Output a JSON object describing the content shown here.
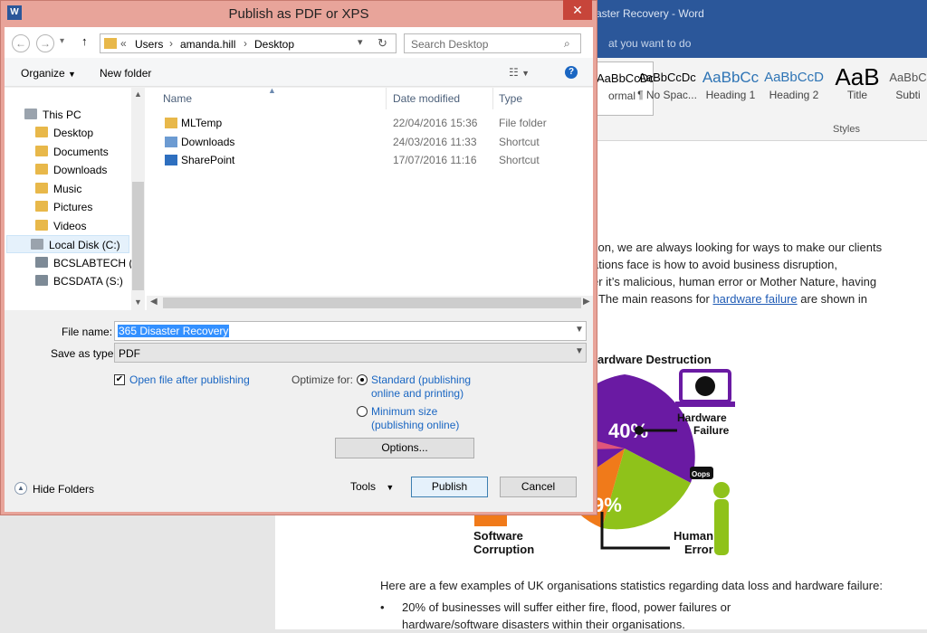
{
  "word": {
    "title": "aster Recovery - Word",
    "tell_me": "at you want to do",
    "styles": [
      {
        "preview": "AaBbCcDc",
        "name": "Normal",
        "shown_name": "ormal"
      },
      {
        "preview": "AaBbCcDc",
        "name": "¶ No Spac..."
      },
      {
        "preview": "AaBbCc",
        "name": "Heading 1"
      },
      {
        "preview": "AaBbCcD",
        "name": "Heading 2"
      },
      {
        "preview": "AaB",
        "name": "Title"
      },
      {
        "preview": "AaBbC",
        "name": "Subti"
      }
    ],
    "styles_group": "Styles",
    "doc_lines": [
      "tion, we are always looking for ways to make our clients",
      "ations face is how to avoid business disruption,",
      "er it’s malicious, human error or Mother Nature, having",
      ". The main reasons for "
    ],
    "doc_link": "hardware failure",
    "doc_line4_tail": " are shown in",
    "infographic": {
      "title": "ardware Destruction",
      "label_hw": "Hardware",
      "label_hw2": "Failure",
      "pct_40": "40%",
      "pct_9": "9%",
      "oops": "Oops",
      "label_sw": "Software",
      "label_sw2": "Corruption",
      "label_he": "Human",
      "label_he2": "Error",
      "colors": {
        "purple": "#6a1aa3",
        "green": "#8fc21a",
        "orange": "#f07a1a",
        "pink": "#e0557a"
      }
    },
    "bottom_para": "Here are a few examples of UK organisations statistics regarding data loss and hardware failure:",
    "bullet_1": "20% of businesses will suffer either fire, flood, power failures or",
    "bullet_1b": "hardware/software disasters within their organisations."
  },
  "dialog": {
    "title": "Publish as PDF or XPS",
    "close": "✕",
    "breadcrumb": [
      "Users",
      "amanda.hill",
      "Desktop"
    ],
    "search_placeholder": "Search Desktop",
    "toolbar": {
      "organize": "Organize",
      "new_folder": "New folder"
    },
    "nav_items": [
      {
        "label": "This PC",
        "icon": "pc-icon"
      },
      {
        "label": "Desktop",
        "icon": "folder-icon"
      },
      {
        "label": "Documents",
        "icon": "folder-icon"
      },
      {
        "label": "Downloads",
        "icon": "folder-icon"
      },
      {
        "label": "Music",
        "icon": "folder-icon"
      },
      {
        "label": "Pictures",
        "icon": "folder-icon"
      },
      {
        "label": "Videos",
        "icon": "folder-icon"
      },
      {
        "label": "Local Disk (C:)",
        "icon": "drive-icon"
      },
      {
        "label": "BCSLABTECH (L:)",
        "icon": "network-drive-icon"
      },
      {
        "label": "BCSDATA (S:)",
        "icon": "network-drive-icon"
      }
    ],
    "columns": {
      "name": "Name",
      "date": "Date modified",
      "type": "Type"
    },
    "files": [
      {
        "name": "MLTemp",
        "date": "22/04/2016 15:36",
        "type": "File folder",
        "icon": "folder-icon"
      },
      {
        "name": "Downloads",
        "date": "24/03/2016 11:33",
        "type": "Shortcut",
        "icon": "shortcut-icon"
      },
      {
        "name": "SharePoint",
        "date": "17/07/2016 11:16",
        "type": "Shortcut",
        "icon": "shortcut-icon"
      }
    ],
    "file_name_label": "File name:",
    "file_name_value": "365 Disaster Recovery",
    "save_type_label": "Save as type:",
    "save_type_value": "PDF",
    "open_after_label": "Open file after publishing",
    "open_after_checked": true,
    "optimize_label": "Optimize for:",
    "opt_standard_1": "Standard (publishing",
    "opt_standard_2": "online and printing)",
    "opt_min_1": "Minimum size",
    "opt_min_2": "(publishing online)",
    "options_button": "Options...",
    "hide_folders": "Hide Folders",
    "tools": "Tools",
    "publish": "Publish",
    "cancel": "Cancel"
  }
}
